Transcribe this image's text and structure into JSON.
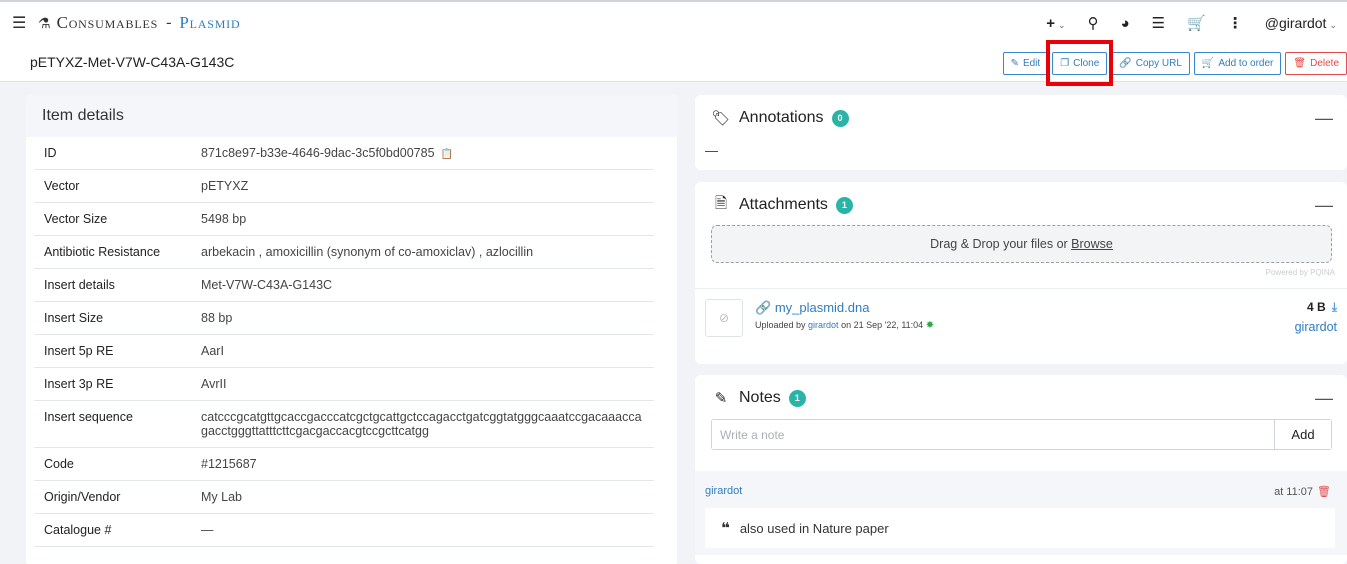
{
  "nav": {
    "menu_icon": "hamburger-icon",
    "section": "Consumables",
    "separator": "-",
    "subsection": "Plasmid",
    "add_label": "+",
    "user": "@girardot"
  },
  "item": {
    "title": "pETYXZ-Met-V7W-C43A-G143C"
  },
  "actions": {
    "edit": "Edit",
    "clone": "Clone",
    "copy_url": "Copy URL",
    "add_to_order": "Add to order",
    "delete": "Delete"
  },
  "details": {
    "heading": "Item details",
    "rows": [
      {
        "label": "ID",
        "value": "871c8e97-b33e-4646-9dac-3c5f0bd00785"
      },
      {
        "label": "Vector",
        "value": "pETYXZ"
      },
      {
        "label": "Vector Size",
        "value": "5498 bp"
      },
      {
        "label": "Antibiotic Resistance",
        "value": "arbekacin , amoxicillin (synonym of co-amoxiclav) , azlocillin"
      },
      {
        "label": "Insert details",
        "value": "Met-V7W-C43A-G143C"
      },
      {
        "label": "Insert Size",
        "value": "88 bp"
      },
      {
        "label": "Insert 5p RE",
        "value": "AarI"
      },
      {
        "label": "Insert 3p RE",
        "value": "AvrII"
      },
      {
        "label": "Insert sequence",
        "value": "catcccgcatgttgcaccgacccatcgctgcattgctccagacctgatcggtatgggcaaatccgacaaacca gacctgggttatttcttcgacgaccacgtccgcttcatgg"
      },
      {
        "label": "Code",
        "value": "#1215687"
      },
      {
        "label": "Origin/Vendor",
        "value": "My Lab"
      },
      {
        "label": "Catalogue #",
        "value": "—"
      }
    ]
  },
  "annotations": {
    "title": "Annotations",
    "count": "0",
    "content": "—",
    "collapse": "—"
  },
  "attachments": {
    "title": "Attachments",
    "count": "1",
    "collapse": "—",
    "dropzone_text": "Drag & Drop your files or ",
    "dropzone_link": "Browse",
    "powered_by": "Powered by PQINA",
    "file": {
      "name": "my_plasmid.dna",
      "uploaded_prefix": "Uploaded by ",
      "uploader": "girardot",
      "uploaded_suffix": " on 21 Sep '22, 11:04",
      "size": "4 B",
      "owner": "girardot"
    }
  },
  "notes": {
    "title": "Notes",
    "count": "1",
    "collapse": "—",
    "placeholder": "Write a note",
    "add_label": "Add",
    "items": [
      {
        "author": "girardot",
        "time": "at 11:07",
        "text": "also used in Nature paper"
      }
    ]
  }
}
